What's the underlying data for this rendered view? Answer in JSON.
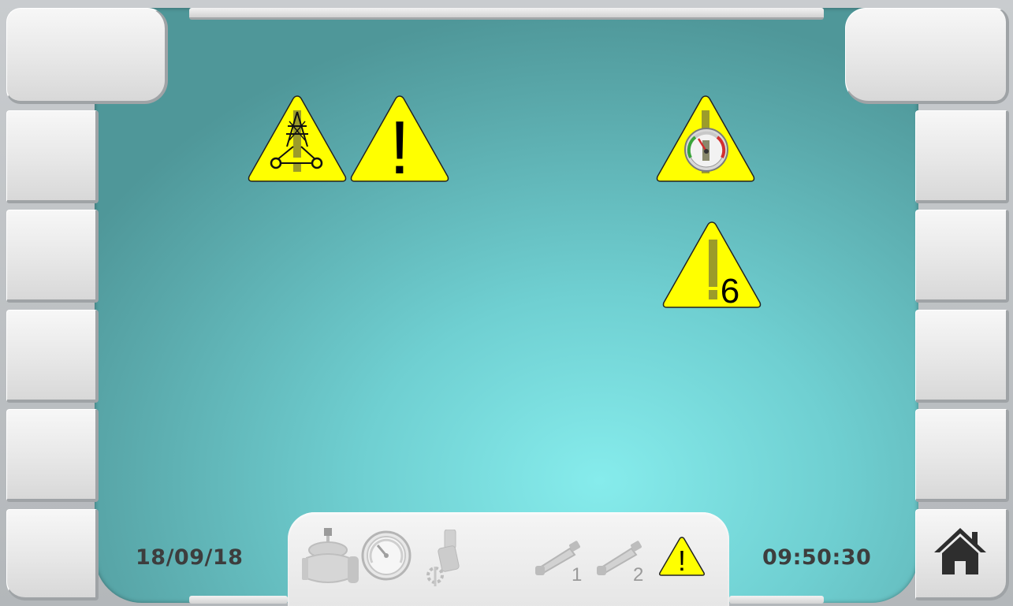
{
  "status_bar": {
    "date": "18/09/18",
    "time": "09:50:30",
    "pump1_label": "1",
    "pump2_label": "2"
  },
  "alarms": {
    "warning_symbol": "!",
    "counter_value": "6"
  },
  "icons": {
    "home": "home-icon",
    "valve": "valve-icon",
    "gauge": "pressure-gauge-icon",
    "actuator": "actuator-icon",
    "pump": "pump-icon",
    "warning": "warning-triangle-icon"
  },
  "colors": {
    "warning_yellow": "#ffff00",
    "panel_teal": "#6fcfd1",
    "bezel_grey": "#e7e7e7",
    "text_dark": "#3d3d3d"
  }
}
